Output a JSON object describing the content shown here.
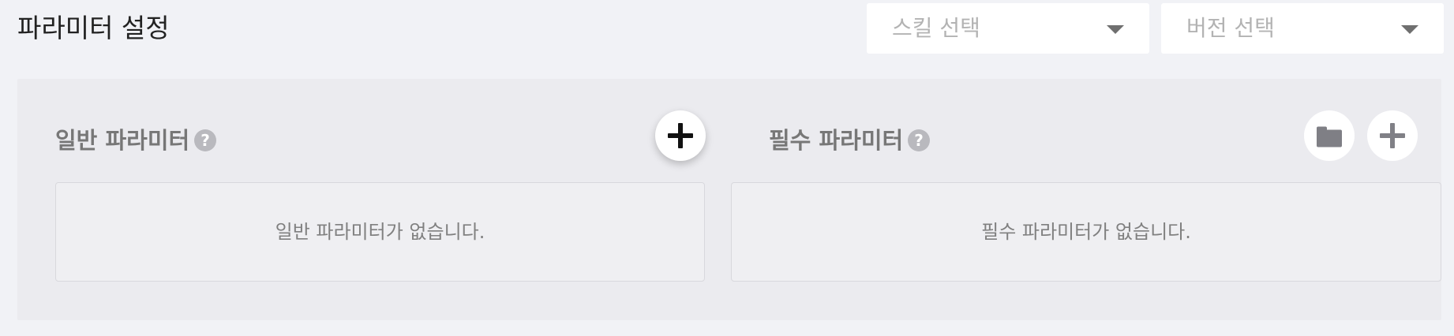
{
  "header": {
    "title": "파라미터 설정",
    "skill_select": {
      "placeholder": "스킬 선택"
    },
    "version_select": {
      "placeholder": "버전 선택"
    }
  },
  "general_params": {
    "title": "일반 파라미터",
    "help_glyph": "?",
    "add_icon": "plus-icon",
    "empty_message": "일반 파라미터가 없습니다."
  },
  "required_params": {
    "title": "필수 파라미터",
    "help_glyph": "?",
    "folder_icon": "folder-icon",
    "add_icon": "plus-icon",
    "empty_message": "필수 파라미터가 없습니다."
  },
  "colors": {
    "page_background": "#f1f2f6",
    "panel_background": "#ebebef",
    "muted_text": "#777777",
    "icon_grey": "#7f7f85"
  }
}
